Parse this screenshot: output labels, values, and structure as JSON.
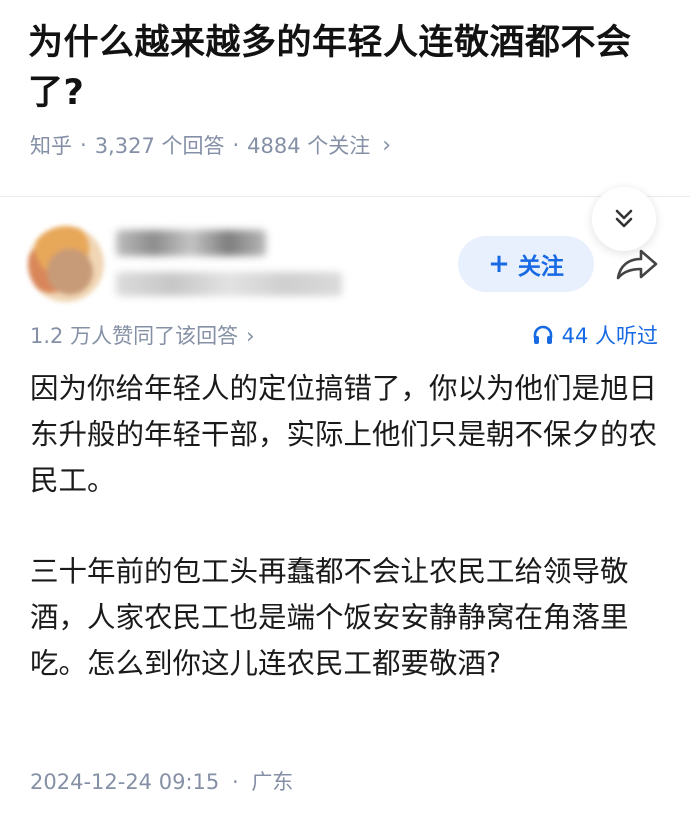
{
  "question": {
    "title": "为什么越来越多的年轻人连敬酒都不会了?",
    "source": "知乎",
    "answers": "3,327 个回答",
    "followers": "4884 个关注",
    "separator": "·"
  },
  "answer": {
    "follow_label": "关注",
    "likes": "1.2 万人赞同了该回答",
    "listens": "44 人听过",
    "paragraphs": [
      "因为你给年轻人的定位搞错了，你以为他们是旭日东升般的年轻干部，实际上他们只是朝不保夕的农民工。",
      "三十年前的包工头再蠢都不会让农民工给领导敬酒，人家农民工也是端个饭安安静静窝在角落里吃。怎么到你这儿连农民工都要敬酒?"
    ],
    "date": "2024-12-24 09:15",
    "location": "广东"
  },
  "colors": {
    "accent": "#1769e4",
    "meta": "#8590a6",
    "follow_bg": "#e8f0fd"
  },
  "icons": [
    "chevron-right-icon",
    "double-chevron-down-icon",
    "plus-icon",
    "share-arrow-icon",
    "headphones-icon"
  ]
}
